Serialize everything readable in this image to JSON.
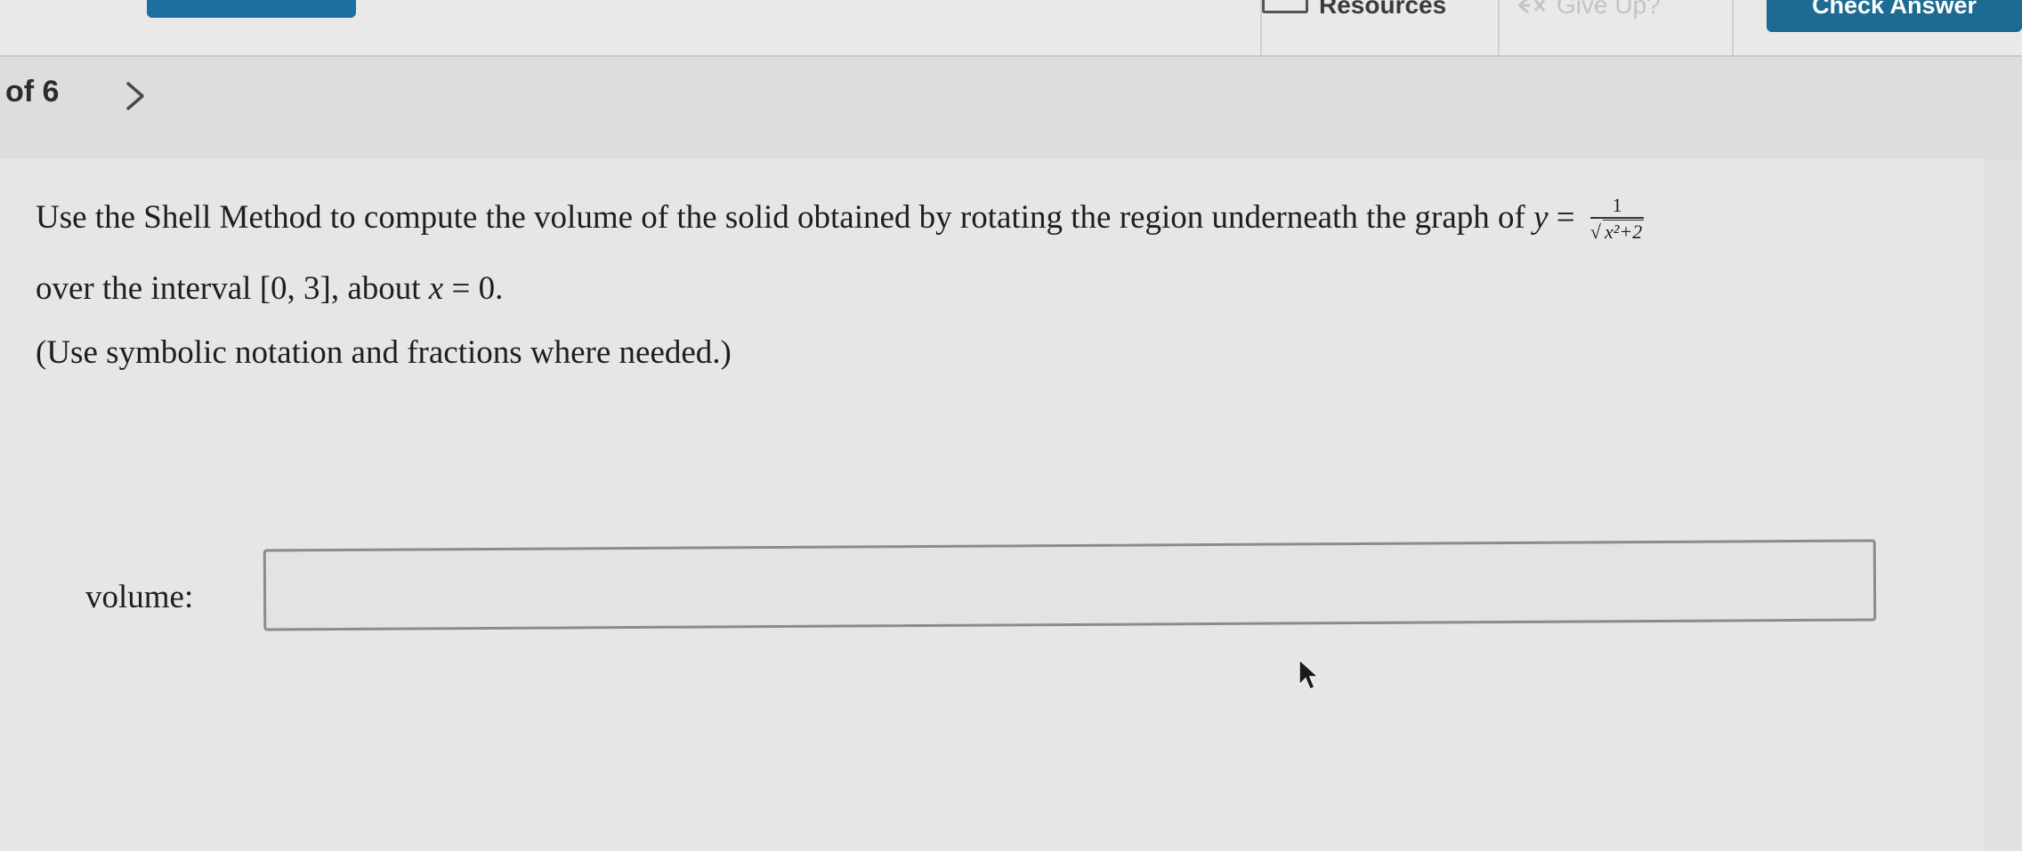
{
  "toolbar": {
    "resources_label": "Resources",
    "give_up_label": "Give Up?",
    "check_answer_label": "Check Answer"
  },
  "nav": {
    "page_count": "of 6"
  },
  "question": {
    "line1_text": "Use the Shell Method to compute the volume of the solid obtained by rotating the region underneath the graph of",
    "y_var": "y",
    "equals": "=",
    "frac_numerator": "1",
    "radical_symbol": "√",
    "radicand": "x²+2",
    "line2_text": "over the interval [0, 3], about",
    "x_var": "x",
    "line2_end": "= 0.",
    "note": "(Use symbolic notation and fractions where needed.)"
  },
  "answer": {
    "label": "volume:",
    "value": "",
    "placeholder": ""
  },
  "colors": {
    "accent": "#1d6a92",
    "background": "#e2e2e0"
  },
  "icons": {
    "resources": "resources-icon",
    "give_up": "give-up-icon",
    "next": "chevron-right-icon",
    "cursor": "mouse-pointer-icon"
  }
}
